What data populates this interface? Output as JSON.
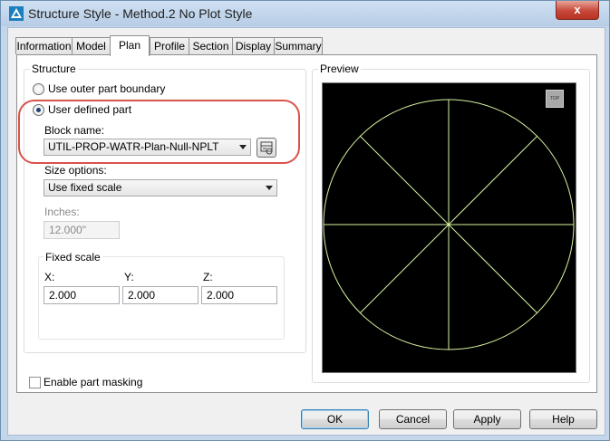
{
  "window": {
    "title": "Structure Style - Method.2 No Plot Style",
    "close_label": "x"
  },
  "tabs": [
    {
      "label": "Information",
      "active": false
    },
    {
      "label": "Model",
      "active": false
    },
    {
      "label": "Plan",
      "active": true
    },
    {
      "label": "Profile",
      "active": false
    },
    {
      "label": "Section",
      "active": false
    },
    {
      "label": "Display",
      "active": false
    },
    {
      "label": "Summary",
      "active": false
    }
  ],
  "structure": {
    "group_label": "Structure",
    "option_outer": {
      "label": "Use outer part boundary",
      "selected": false
    },
    "option_user": {
      "label": "User defined part",
      "selected": true
    },
    "block_name_label": "Block name:",
    "block_name_value": "UTIL-PROP-WATR-Plan-Null-NPLT",
    "size_options_label": "Size options:",
    "size_options_value": "Use fixed scale",
    "inches_label": "Inches:",
    "inches_value": "12.000\"",
    "fixed_scale": {
      "group_label": "Fixed scale",
      "x_label": "X:",
      "y_label": "Y:",
      "z_label": "Z:",
      "x_value": "2.000",
      "y_value": "2.000",
      "z_value": "2.000"
    }
  },
  "preview": {
    "label": "Preview",
    "view_cube_label": "TOP",
    "line_color": "#d7f5a0"
  },
  "masking": {
    "label": "Enable part masking",
    "checked": false
  },
  "buttons": {
    "ok": "OK",
    "cancel": "Cancel",
    "apply": "Apply",
    "help": "Help"
  },
  "colors": {
    "highlight": "#d9534a",
    "title_bar": "#c4d6ea"
  }
}
